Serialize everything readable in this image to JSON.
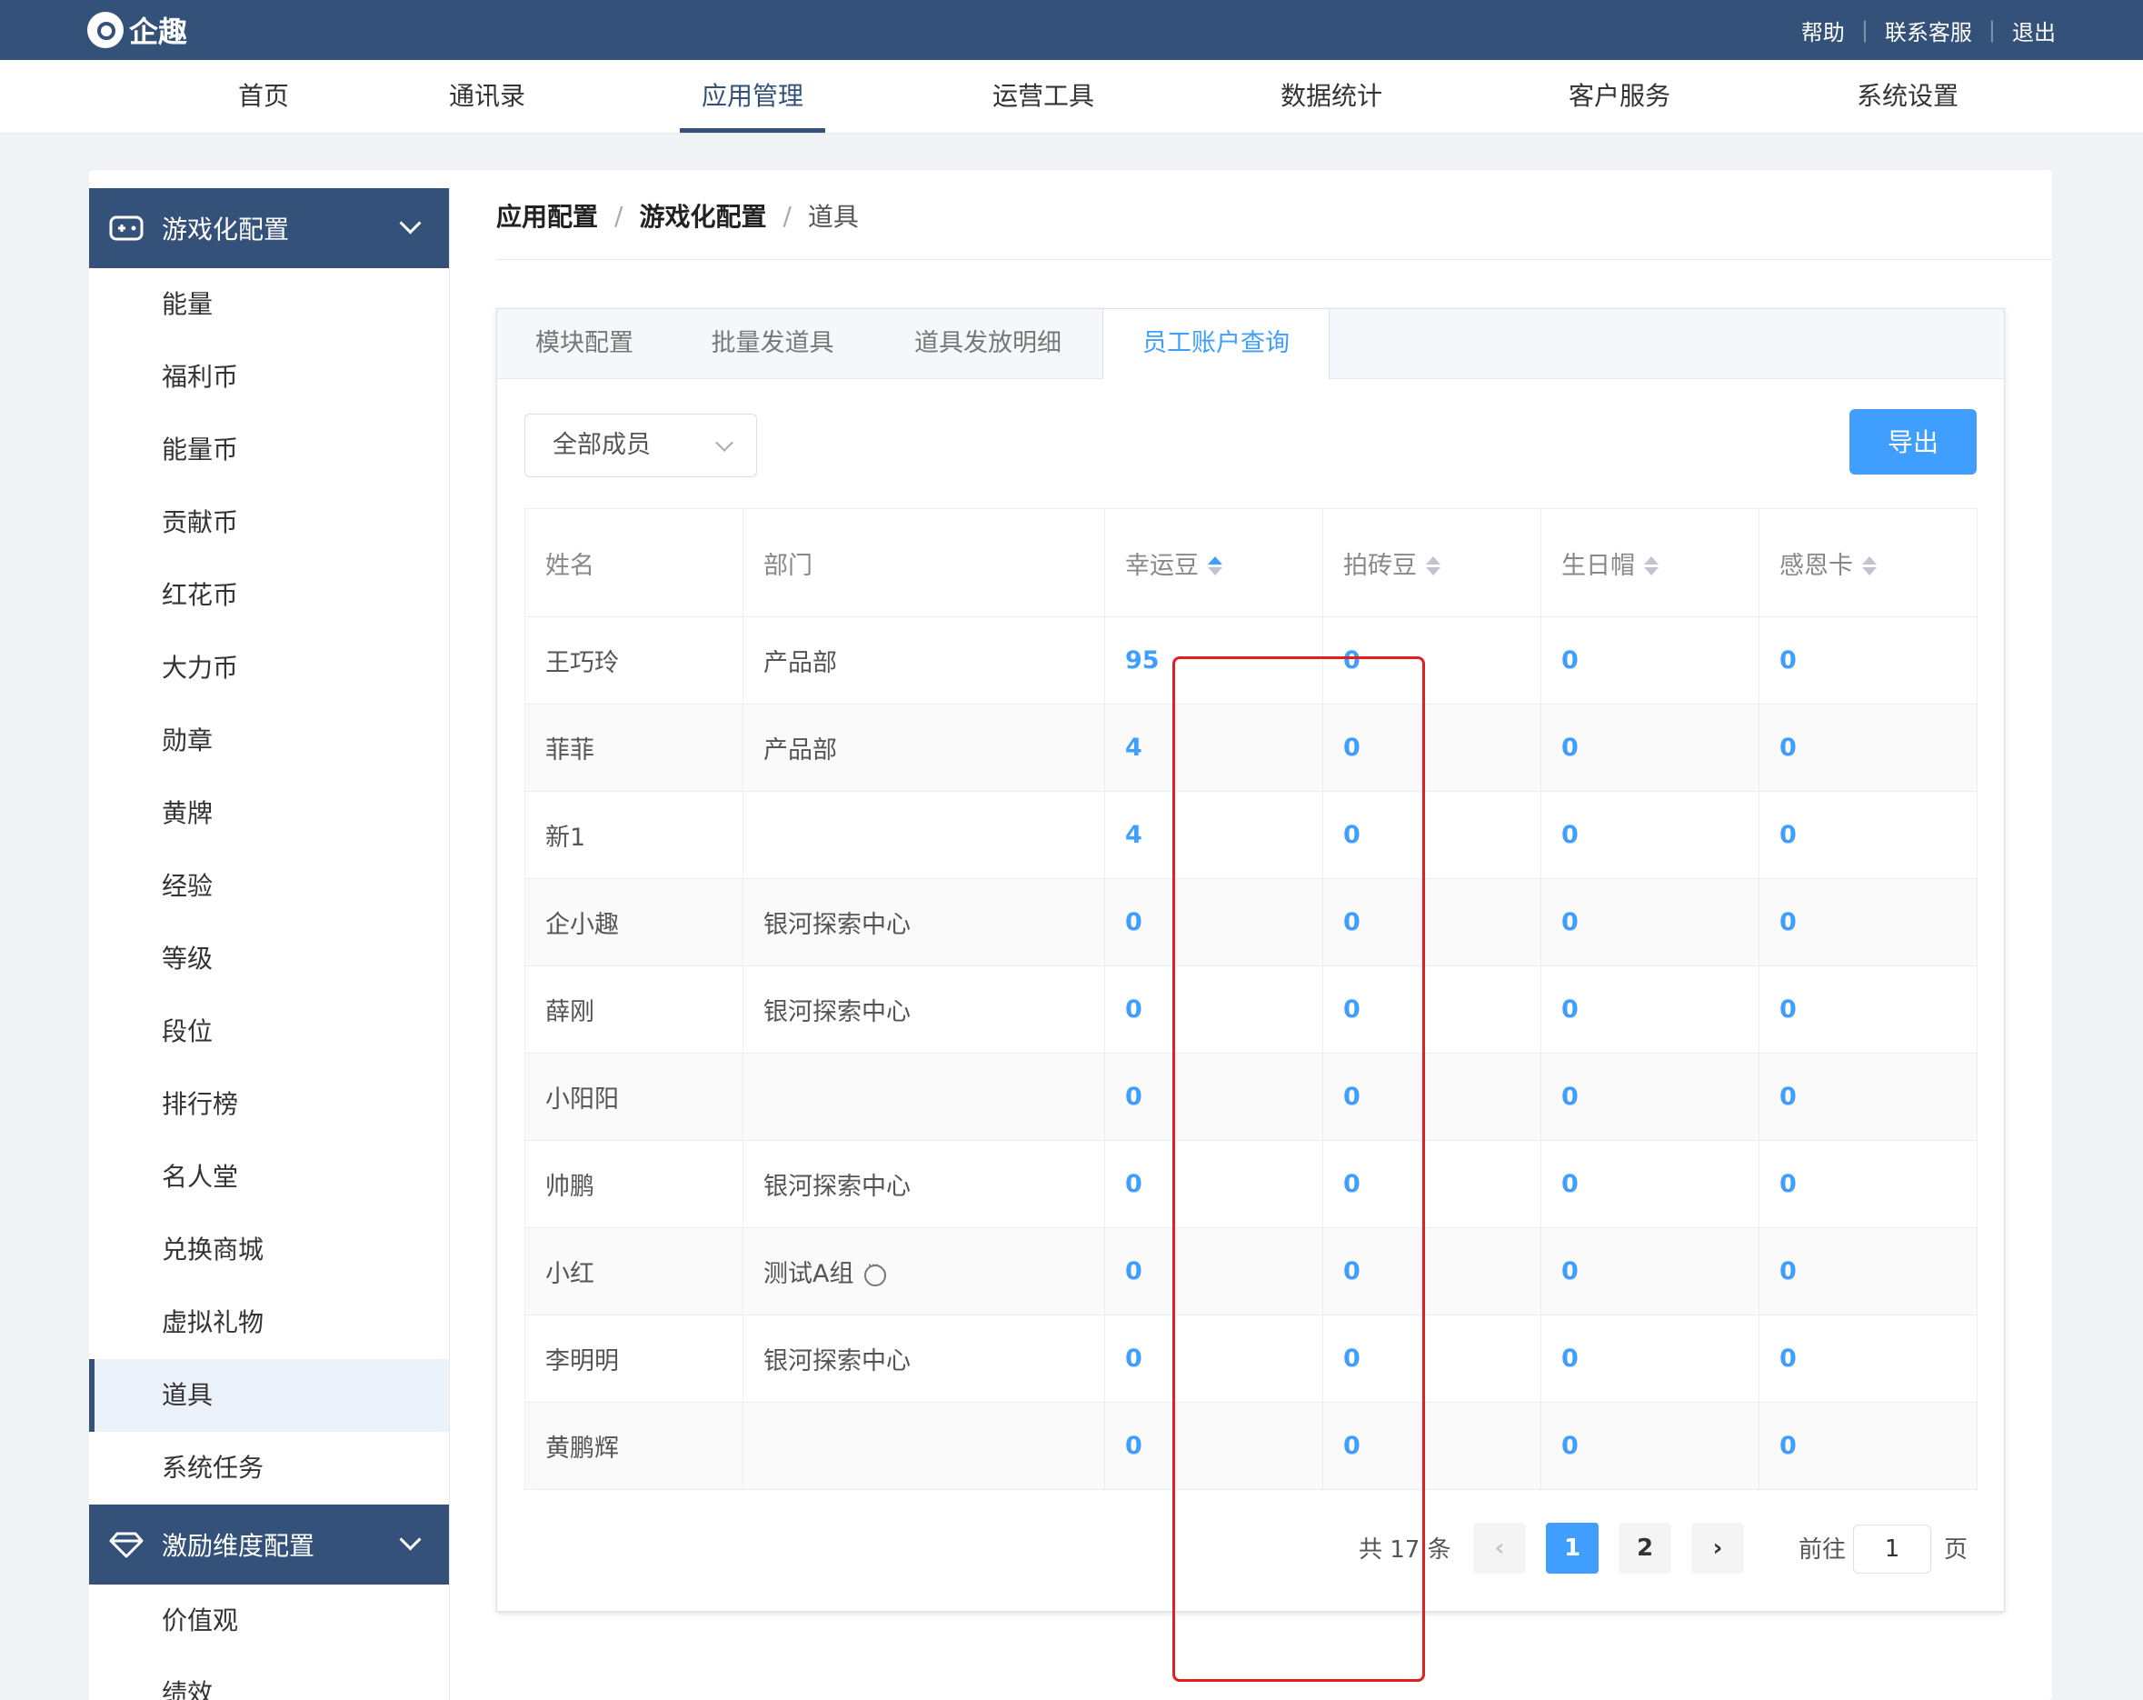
{
  "topbar": {
    "brand": "企趣",
    "links": [
      "帮助",
      "联系客服",
      "退出"
    ]
  },
  "nav": {
    "items": [
      "首页",
      "通讯录",
      "应用管理",
      "运营工具",
      "数据统计",
      "客户服务",
      "系统设置"
    ],
    "active": "应用管理"
  },
  "sidebar": {
    "group1": {
      "title": "游戏化配置",
      "icon": "gamepad-icon",
      "items": [
        "能量",
        "福利币",
        "能量币",
        "贡献币",
        "红花币",
        "大力币",
        "勋章",
        "黄牌",
        "经验",
        "等级",
        "段位",
        "排行榜",
        "名人堂",
        "兑换商城",
        "虚拟礼物",
        "道具",
        "系统任务"
      ],
      "active": "道具"
    },
    "group2": {
      "title": "激励维度配置",
      "icon": "diamond-icon",
      "items": [
        "价值观",
        "绩效"
      ]
    }
  },
  "breadcrumb": [
    "应用配置",
    "游戏化配置",
    "道具"
  ],
  "tabs": {
    "items": [
      "模块配置",
      "批量发道具",
      "道具发放明细",
      "员工账户查询"
    ],
    "active": "员工账户查询"
  },
  "filter": {
    "member_select": "全部成员"
  },
  "export_label": "导出",
  "table": {
    "columns": [
      "姓名",
      "部门",
      "幸运豆",
      "拍砖豆",
      "生日帽",
      "感恩卡"
    ],
    "rows": [
      {
        "name": "王巧玲",
        "dept": "产品部",
        "v1": "95",
        "v2": "0",
        "v3": "0",
        "v4": "0"
      },
      {
        "name": "菲菲",
        "dept": "产品部",
        "v1": "4",
        "v2": "0",
        "v3": "0",
        "v4": "0"
      },
      {
        "name": "新1",
        "dept": "",
        "v1": "4",
        "v2": "0",
        "v3": "0",
        "v4": "0"
      },
      {
        "name": "企小趣",
        "dept": "银河探索中心",
        "v1": "0",
        "v2": "0",
        "v3": "0",
        "v4": "0"
      },
      {
        "name": "薛刚",
        "dept": "银河探索中心",
        "v1": "0",
        "v2": "0",
        "v3": "0",
        "v4": "0"
      },
      {
        "name": "小阳阳",
        "dept": "",
        "v1": "0",
        "v2": "0",
        "v3": "0",
        "v4": "0"
      },
      {
        "name": "帅鹏",
        "dept": "银河探索中心",
        "v1": "0",
        "v2": "0",
        "v3": "0",
        "v4": "0"
      },
      {
        "name": "小红",
        "dept": "测试A组",
        "v1": "0",
        "v2": "0",
        "v3": "0",
        "v4": "0"
      },
      {
        "name": "李明明",
        "dept": "银河探索中心",
        "v1": "0",
        "v2": "0",
        "v3": "0",
        "v4": "0"
      },
      {
        "name": "黄鹏辉",
        "dept": "",
        "v1": "0",
        "v2": "0",
        "v3": "0",
        "v4": "0"
      }
    ]
  },
  "pagination": {
    "total_label": "共 17 条",
    "pages": [
      "1",
      "2"
    ],
    "current": "1",
    "goto_prefix": "前往",
    "goto_value": "1",
    "goto_suffix": "页"
  },
  "colors": {
    "brand": "#345279",
    "accent": "#409eff",
    "highlight": "#e02020"
  }
}
